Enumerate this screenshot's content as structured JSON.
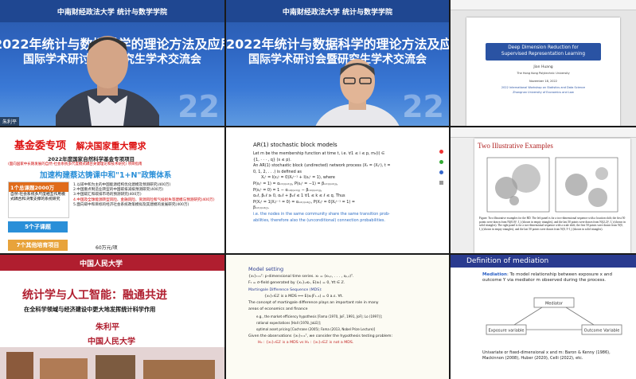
{
  "tiles": {
    "conf_left": {
      "header": "中南财经政法大学 统计与数学学院",
      "title_line1": "2022年统计与数据科学的理论方法及应用",
      "title_line2": "国际学术研讨会暨研究生学术交流会",
      "big_text": "22",
      "name_tag": "朱利平"
    },
    "conf_mid": {
      "header": "中南财经政法大学 统计与数学学院",
      "title_line1": "2022年统计与数据科学的理论方法及应用",
      "title_line2": "国际学术研讨会暨研究生学术交流会",
      "big_text": "22"
    },
    "pdf_top_right": {
      "paper_title_1": "Deep Dimension Reduction for",
      "paper_title_2": "Supervised Representation Learning",
      "author": "Jian Huang",
      "affil": "The Hong Kong Polytechnic University",
      "date": "November 18, 2022",
      "event_1": "2022 International Workshop on Statistics and Data Science",
      "event_2": "Zhongnan University of Economics and Law"
    },
    "fund_slide": {
      "title": "基金委专项",
      "subtitle": "解决国家重大需求",
      "item_header": "2022年度国家自然科学基金专项项目",
      "item_sub": "(面向国家中长期发展的自然-社会系统多尺度模式耦合关键理论和技术研究) 项目指南",
      "banner": "加速构建蔡达铸课中和\"1+N\"政策体系",
      "box1_title": "1个总课题2000万",
      "box1_body": "自然-社会系统多尺度相互作用模式耦合和决策支撑的系统研究",
      "box2_title": "5个子课题",
      "box3_title": "7个其他培育项目",
      "bullets": [
        "1.以碳中和为主的中国能源结构优化建模及预测研究(400万)",
        "2.中国重点制造业转型的中国碳排减排预测研究(400万)",
        "3.中国碳汇和碳排市场的预测研究(400万)",
        "4.中国及全球能源转型风险、金融风险、资源风险和气候损失等建模与预测研究(400万)",
        "5.面向碳中和目标的经济社会系统政策模拟及其建模的发展研究(400万)"
      ],
      "footer": "60万元/项"
    },
    "ar_slide": {
      "title": "AR(1) stochastic block models",
      "lines": [
        "Let m be the membership function at time t, i.e.  ∀1 ≤ i ≤ p, mₜ(i) ∈",
        "{1, · · · , q}  (s ≤ p).",
        "An AR(1) stochastic block (undirected) network process (Xₜ = (Xᵢⱼᵗ), t =",
        "0, 1, 2, . . .) is defined as",
        "Xᵢⱼᵗ = I(εᵢⱼᵗ = 0)Xᵢⱼᵗ⁻¹ + I(εᵢⱼᵗ = 1),   where",
        "P(εᵢⱼᵗ = 1) = αₘₜ₍ᵢ₎ₘₜ₍ⱼ₎,   P(εᵢⱼᵗ = −1) = βₘₜ₍ᵢ₎ₘₜ₍ⱼ₎,",
        "P(εᵢⱼᵗ = 0) = 1 − αₘₜ₍ᵢ₎ₘₜ₍ⱼ₎ − βₘₜ₍ᵢ₎ₘₜ₍ⱼ₎,",
        "αₖℓ, βₖℓ ≥ 0, αₖℓ + βₖℓ ≤ 1 ∀1 ≤ k ≤ ℓ ≤ q. Thus",
        "P(Xᵢⱼᵗ = 1|Xᵢⱼᵗ⁻¹ = 0) = αₘₜ₍ᵢ₎ₘₜ₍ⱼ₎,  P(Xᵢⱼᵗ = 0|Xᵢⱼᵗ⁻¹ = 1) =",
        "βₘₜ₍ᵢ₎ₘₜ₍ⱼ₎.",
        "i.e. the nodes in the same community share the same transition prob-",
        "abilities, therefore also the (unconditional) connection probabilities."
      ]
    },
    "illustrative": {
      "section_title": "Two Illustrative Examples",
      "caption": "Figure: Two illustrative examples for the RD. The left panel is for a two-dimensional sequence with a location shift; the first 50 points were drawn from N((0,0)ᵀ, I₂) (shown in empty triangles), and the last 50 points were drawn from N((2,2)ᵀ, I₂) (shown in solid triangles). The right panel is for a two-dimensional sequence with a scale shift; the first 50 points were drawn from N(0, I₂) (shown in empty triangles), and the last 50 points were drawn from N(0, 5² I₂) (shown in solid triangles)."
    },
    "stats_ai": {
      "school": "中国人民大学",
      "title": "统计学与人工智能：融通共进",
      "subtitle": "在全科学领域与经济建设中更大地发挥统计科学作用",
      "speaker": "朱利平",
      "affil": "中国人民大学"
    },
    "model_setting": {
      "title": "Model setting",
      "lines": [
        "{xₜ}ₜ₌₁ᵀ: p-dimensional time series. xₜ = (x₁,ₜ, . . . , xₚ,ₜ)ᵀ.",
        "Fₜ = σ-field generated by {xₛ}ₛ≤ₜ,  E(xₜ) = 0, ∀t ∈ ℤ.",
        "Martingale Difference Sequence (MDS):",
        "{xₜ}ₜ∈ℤ is a MDS   ⟺   E(xₜ|Fₜ₋₁) = 0  a.s. ∀t.",
        "The concept of martingale difference plays an important role in many",
        "areas of economics and finance",
        "e.g., the market efficiency hypothesis [Fama (1970, JoF, 1991, JoF); Lo (1997)];",
        "rational expectations [Hall (1978, JoLE)];",
        "optimal asset pricing [Cochrane (2005); Fama (2013, Nobel Prize Lecture)]",
        "Given the observations {xₜ}ₜ₌₁ᵀ, we consider the hypothesis testing problem:",
        "H₀ : {xₜ}ₜ∈ℤ is a MDS   vs   H₁ : {xₜ}ₜ∈ℤ is not a MDS."
      ]
    },
    "mediation": {
      "title": "Definition of mediation",
      "body_label": "Mediation",
      "body": ": To model relationship between exposure x and outcome Y via mediator m observed during the process.",
      "node_m": "Mediator",
      "node_x": "Exposure variable",
      "node_y": "Outcome Variable",
      "bullet": "Univariate or fixed-dimensional x and m: Baron & Kenny (1986), Mackinnon (2008), Huber (2020), Celli (2022), etc."
    }
  }
}
